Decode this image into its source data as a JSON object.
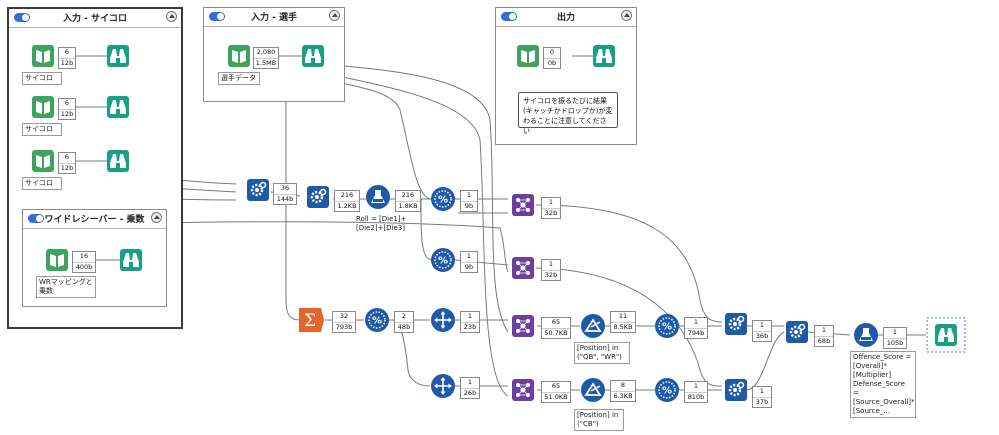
{
  "containers": {
    "dice": {
      "title": "入力 - サイコロ"
    },
    "players": {
      "title": "入力 - 選手"
    },
    "output": {
      "title": "出力"
    },
    "wr": {
      "title": "ワイドレシーバー - 乗数"
    }
  },
  "labels": {
    "dice1": "サイコロ 1",
    "dice2": "サイコロ 2",
    "dice3": "サイコロ 3",
    "players_data": "選手データ",
    "wr_map": "WRマッピングと乗数"
  },
  "note": "サイコロを振るたびに結果 (キャッチかドロップか)が変わることに注意してください",
  "metrics": {
    "dice1": [
      "6",
      "12b"
    ],
    "dice2": [
      "6",
      "12b"
    ],
    "dice3": [
      "6",
      "12b"
    ],
    "players": [
      "2,080",
      "1.5MB"
    ],
    "output": [
      "0",
      "0b"
    ],
    "wr": [
      "16",
      "400b"
    ],
    "append1": [
      "36",
      "144b"
    ],
    "append2": [
      "216",
      "1.2KB"
    ],
    "formula1": [
      "216",
      "1.8KB"
    ],
    "sample1": [
      "1",
      "9b"
    ],
    "sample2": [
      "1",
      "9b"
    ],
    "join_top": [
      "1",
      "32b"
    ],
    "join_mid": [
      "1",
      "32b"
    ],
    "summarize": [
      "32",
      "793b"
    ],
    "sample_mid": [
      "2",
      "48b"
    ],
    "cross1": [
      "1",
      "23b"
    ],
    "cross2": [
      "1",
      "26b"
    ],
    "join_b1": [
      "65",
      "50.7KB"
    ],
    "join_b2": [
      "65",
      "51.0KB"
    ],
    "filter1": [
      "11",
      "8.5KB"
    ],
    "filter2": [
      "8",
      "6.3KB"
    ],
    "sample_r1": [
      "1",
      "794b"
    ],
    "sample_r2": [
      "1",
      "810b"
    ],
    "append_r1": [
      "1",
      "36b"
    ],
    "append_r2": [
      "1",
      "37b"
    ],
    "append_final": [
      "1",
      "68b"
    ],
    "formula_final": [
      "1",
      "105b"
    ]
  },
  "expressions": {
    "roll": [
      "Roll = [Die1]+",
      "[Die2]+[Die3]"
    ],
    "filter1": [
      "[Position] in",
      "(\"QB\", \"WR\")"
    ],
    "filter2": [
      "[Position] in",
      "(\"CB\")"
    ],
    "final": [
      "Offence_Score =",
      "[Overall]*",
      "[Multiplier]",
      "Defense_Score =",
      "[Source_Overall]*",
      "[Source_..."
    ]
  },
  "colors": {
    "input_tool": "#3ea35f",
    "browse_tool": "#16a085",
    "preparation_tool": "#1e5aa8",
    "join_tool": "#6b3fa0",
    "summarize_tool": "#e8622c",
    "toggle": "#2f6fd6",
    "wire": "#7a7a7a"
  },
  "icons": {
    "input": "book-icon",
    "browse": "binoculars-icon",
    "append": "gears-icon",
    "formula": "flask-icon",
    "sample": "percent-icon",
    "join": "network-icon",
    "summarize": "sigma-icon",
    "cross_tab": "arrows-cross-icon",
    "filter": "triangle-filter-icon"
  }
}
